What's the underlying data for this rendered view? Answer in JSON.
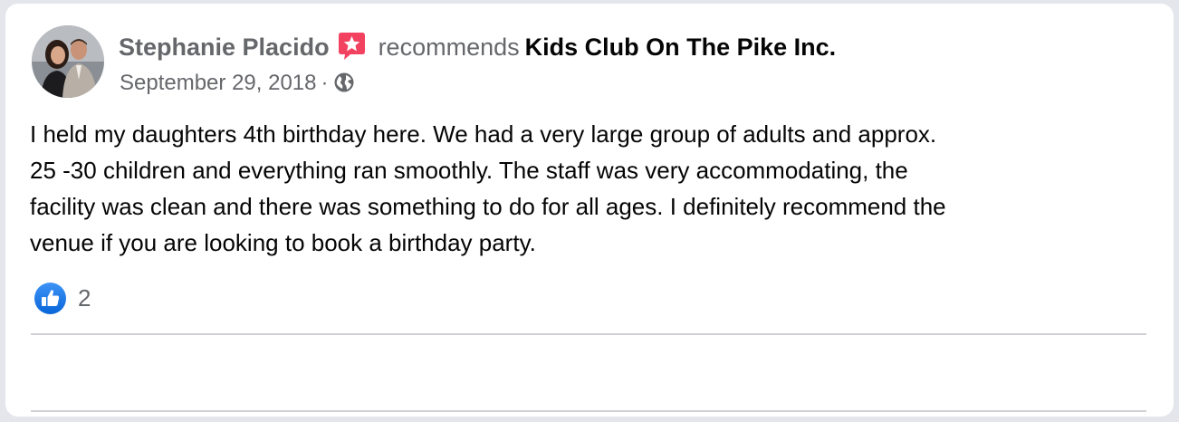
{
  "post": {
    "author": "Stephanie Placido",
    "verb": "recommends",
    "target": "Kids Club On The Pike Inc.",
    "date": "September 29, 2018",
    "separator": "·",
    "body_lines": [
      "I held my daughters 4th birthday here.  We had a very large group of adults and approx.",
      "25 -30 children and everything ran smoothly.  The staff was very accommodating, the",
      "facility was clean and there was something to do for all ages.  I definitely recommend the",
      "venue if you are looking to book a birthday party."
    ],
    "reaction_count": "2"
  },
  "icons": {
    "avatar": "profile-photo",
    "recommend_badge": "star-recommendation-icon",
    "privacy": "globe-icon",
    "reaction": "like-icon"
  },
  "colors": {
    "secondary_text": "#65676b",
    "primary_text": "#050505",
    "recommend_badge": "#f3425f",
    "like_blue": "#1877f2"
  }
}
